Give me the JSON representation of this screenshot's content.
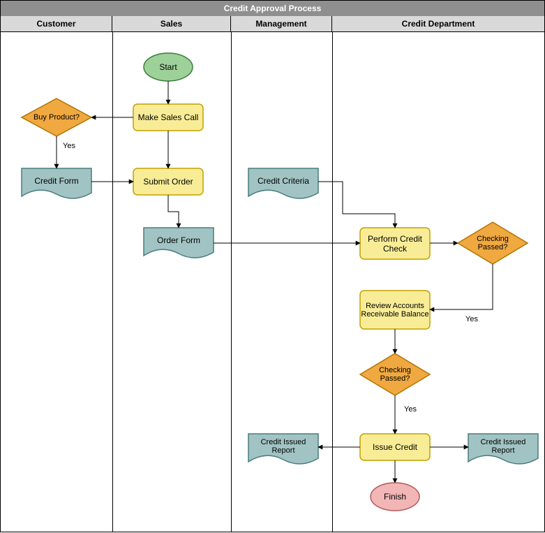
{
  "title": "Credit Approval Process",
  "lanes": [
    "Customer",
    "Sales",
    "Management",
    "Credit Department"
  ],
  "nodes": {
    "start": "Start",
    "make_sales_call": "Make Sales Call",
    "buy_product": "Buy Product?",
    "buy_product_yes": "Yes",
    "credit_form": "Credit Form",
    "submit_order": "Submit Order",
    "order_form": "Order Form",
    "credit_criteria": "Credit Criteria",
    "perform_credit_check": "Perform Credit Check",
    "checking_passed_1": "Checking Passed?",
    "checking_passed_1_yes": "Yes",
    "review_ar": "Review Accounts Receivable Balance",
    "checking_passed_2": "Checking Passed?",
    "checking_passed_2_yes": "Yes",
    "issue_credit": "Issue Credit",
    "credit_issued_report_left": "Credit Issued Report",
    "credit_issued_report_right": "Credit Issued Report",
    "finish": "Finish"
  },
  "colors": {
    "green_fill": "#9ed199",
    "green_stroke": "#397d3a",
    "yellow_fill": "#f8ed96",
    "yellow_stroke": "#c1a100",
    "orange_fill": "#f0a840",
    "orange_stroke": "#b37400",
    "teal_fill": "#a1c3c3",
    "teal_stroke": "#4a7c7c",
    "pink_fill": "#f3b6b6",
    "pink_stroke": "#b35a5a"
  }
}
